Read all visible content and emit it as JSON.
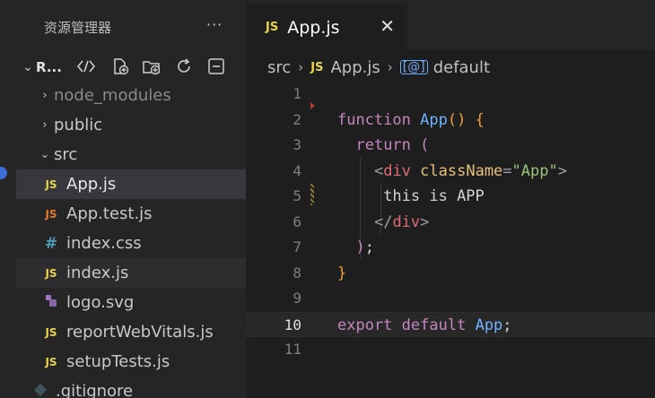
{
  "sidebar": {
    "title": "资源管理器",
    "more": "···",
    "project": "R...",
    "items": [
      {
        "label": "node_modules",
        "icon": "chevron-right",
        "type": "folder"
      },
      {
        "label": "public",
        "icon": "chevron-right",
        "type": "folder"
      },
      {
        "label": "src",
        "icon": "chevron-down",
        "type": "folder"
      },
      {
        "label": "App.js",
        "badge": "JS",
        "type": "file"
      },
      {
        "label": "App.test.js",
        "badge": "JS",
        "type": "file"
      },
      {
        "label": "index.css",
        "badge": "#",
        "type": "file"
      },
      {
        "label": "index.js",
        "badge": "JS",
        "type": "file"
      },
      {
        "label": "logo.svg",
        "badge": "svg-icon",
        "type": "file"
      },
      {
        "label": "reportWebVitals.js",
        "badge": "JS",
        "type": "file"
      },
      {
        "label": "setupTests.js",
        "badge": "JS",
        "type": "file"
      },
      {
        "label": ".gitignore",
        "badge": "git-icon",
        "type": "file"
      }
    ],
    "badges": {
      "js": "JS",
      "css": "#"
    }
  },
  "editor": {
    "tab": {
      "badge": "JS",
      "label": "App.js",
      "close": "✕"
    },
    "breadcrumbs": {
      "folder": "src",
      "badge": "JS",
      "file": "App.js",
      "symbol": "default"
    },
    "lines": [
      "1",
      "2",
      "3",
      "4",
      "5",
      "6",
      "7",
      "8",
      "9",
      "10",
      "11"
    ],
    "current_line": "10",
    "code": {
      "l2_kw": "function",
      "l2_fn": "App",
      "l2_paren": "()",
      "l2_brace": "{",
      "l3_kw": "return",
      "l3_paren": "(",
      "l4_open": "<",
      "l4_tag": "div",
      "l4_attr": "className",
      "l4_eq": "=",
      "l4_str": "\"App\"",
      "l4_close": ">",
      "l5_text": "this is APP",
      "l6_open": "</",
      "l6_tag": "div",
      "l6_close": ">",
      "l7_paren": ")",
      "l7_semi": ";",
      "l8_brace": "}",
      "l10_kw1": "export",
      "l10_kw2": "default",
      "l10_fn": "App",
      "l10_semi": ";"
    }
  },
  "colors": {
    "accent": "#3b6fd6",
    "js_badge": "#e8d44d",
    "css_badge": "#519aba",
    "keyword": "#c586c0",
    "function": "#6fb3ff",
    "string": "#98c379",
    "tag": "#e06c75",
    "attribute": "#e5c07b"
  }
}
